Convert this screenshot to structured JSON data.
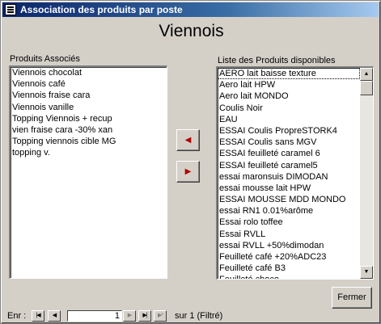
{
  "window": {
    "title": "Association des produits par poste"
  },
  "form": {
    "heading": "Viennois"
  },
  "associated": {
    "label": "Produits Associés",
    "items": [
      "Viennois chocolat",
      "Viennois café",
      "Viennois fraise cara",
      "Viennois vanille",
      "Topping Viennois + recup",
      "vien fraise cara -30% xan",
      "Topping viennois cible MG",
      "topping v."
    ]
  },
  "available": {
    "label": "Liste des Produits disponibles",
    "items": [
      "AERO lait baisse texture",
      "Aero lait HPW",
      "Aero lait MONDO",
      "Coulis Noir",
      "EAU",
      "ESSAI Coulis PropreSTORK4",
      "ESSAI Coulis sans MGV",
      "ESSAI feuilleté caramel 6",
      "ESSAI feuilleté caramel5",
      "essai maronsuis DIMODAN",
      "essai mousse lait HPW",
      "ESSAI MOUSSE MDD MONDO",
      "essai RN1 0.01%arôme",
      "Essai rolo toffee",
      "Essai RVLL",
      "essai RVLL +50%dimodan",
      "Feuilleté café +20%ADC23",
      "Feuilleté café B3",
      "Feuilleté choco"
    ]
  },
  "buttons": {
    "remove_icon": "arrow-left-icon",
    "add_icon": "arrow-right-icon",
    "close": "Fermer"
  },
  "nav": {
    "label": "Enr :",
    "current": "1",
    "total_text": "sur  1 (Filtré)"
  },
  "colors": {
    "title_start": "#0a246a",
    "title_end": "#a6caf0",
    "arrow": "#b00000",
    "face": "#d4d0c8"
  }
}
